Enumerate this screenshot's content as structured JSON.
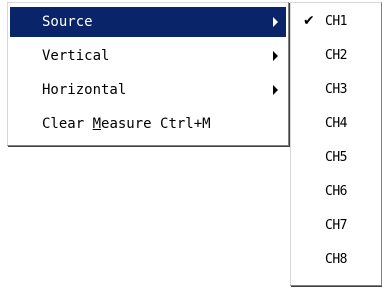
{
  "menu": {
    "items": [
      {
        "label": "Source",
        "has_submenu": true,
        "selected": true
      },
      {
        "label": "Vertical",
        "has_submenu": true,
        "selected": false
      },
      {
        "label": "Horizontal",
        "has_submenu": true,
        "selected": false
      },
      {
        "label_pre": "Clear ",
        "label_mnemonic": "M",
        "label_post": "easure Ctrl+M",
        "has_submenu": false,
        "selected": false
      }
    ]
  },
  "submenu": {
    "items": [
      {
        "label": "CH1",
        "checked": true
      },
      {
        "label": "CH2",
        "checked": false
      },
      {
        "label": "CH3",
        "checked": false
      },
      {
        "label": "CH4",
        "checked": false
      },
      {
        "label": "CH5",
        "checked": false
      },
      {
        "label": "CH6",
        "checked": false
      },
      {
        "label": "CH7",
        "checked": false
      },
      {
        "label": "CH8",
        "checked": false
      }
    ],
    "check_glyph": "✔"
  },
  "colors": {
    "highlight": "#0a246a",
    "highlight_text": "#ffffff",
    "text": "#000000",
    "background": "#ffffff"
  }
}
